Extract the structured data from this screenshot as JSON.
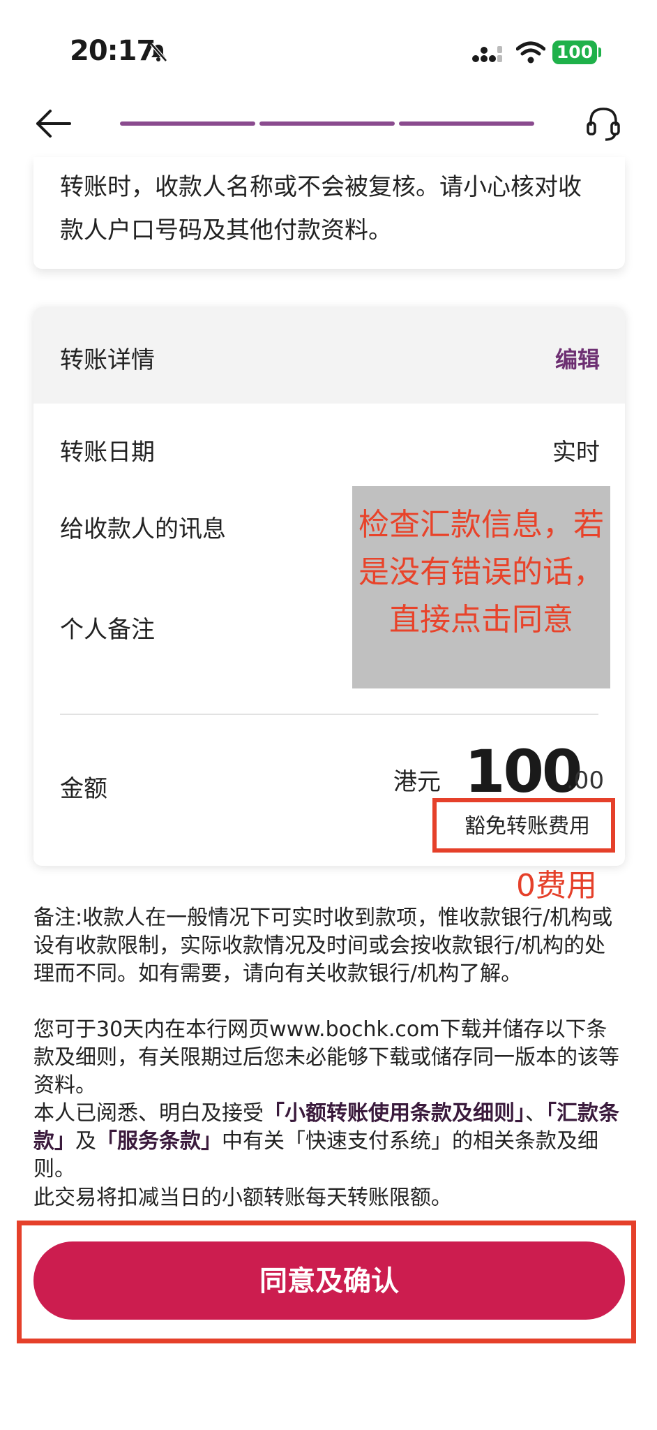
{
  "status_bar": {
    "time": "20:17",
    "battery": "100"
  },
  "top_card": {
    "notice": "转账时，收款人名称或不会被复核。请小心核对收款人户口号码及其他付款资料。"
  },
  "detail": {
    "title": "转账详情",
    "edit": "编辑",
    "rows": [
      {
        "label": "转账日期",
        "value": "实时"
      },
      {
        "label": "给收款人的讯息"
      },
      {
        "label": "个人备注"
      }
    ],
    "amount_label": "金额",
    "currency": "港元",
    "amount_integer": "100",
    "amount_decimal": ".00",
    "fee_note": "豁免转账费用"
  },
  "annotation": {
    "overlay_text": "检查汇款信息，若是没有错误的话，直接点击同意",
    "fee_text": "0费用"
  },
  "remarks": {
    "p1": "备注:收款人在一般情况下可实时收到款项，惟收款银行/机构或设有收款限制，实际收款情况及时间或会按收款银行/机构的处理而不同。如有需要，请向有关收款银行/机构了解。",
    "p2": "您可于30天内在本行网页www.bochk.com下载并储存以下条款及细则，有关限期过后您未必能够下载或储存同一版本的该等资料。",
    "p3_a": "本人已阅悉、明白及接受",
    "p3_link1": "「小额转账使用条款及细则」",
    "p3_b": "、",
    "p3_link2": "「汇款条款」",
    "p3_c": "及",
    "p3_link3": "「服务条款」",
    "p3_d": "中有关「快速支付系统」的相关条款及细则。",
    "p4": "此交易将扣减当日的小额转账每天转账限额。"
  },
  "button": {
    "agree": "同意及确认"
  },
  "colors": {
    "brand": "#cc1d4f",
    "accent": "#8a4b8e",
    "annotation": "#e5402a",
    "battery": "#1fb14a"
  }
}
